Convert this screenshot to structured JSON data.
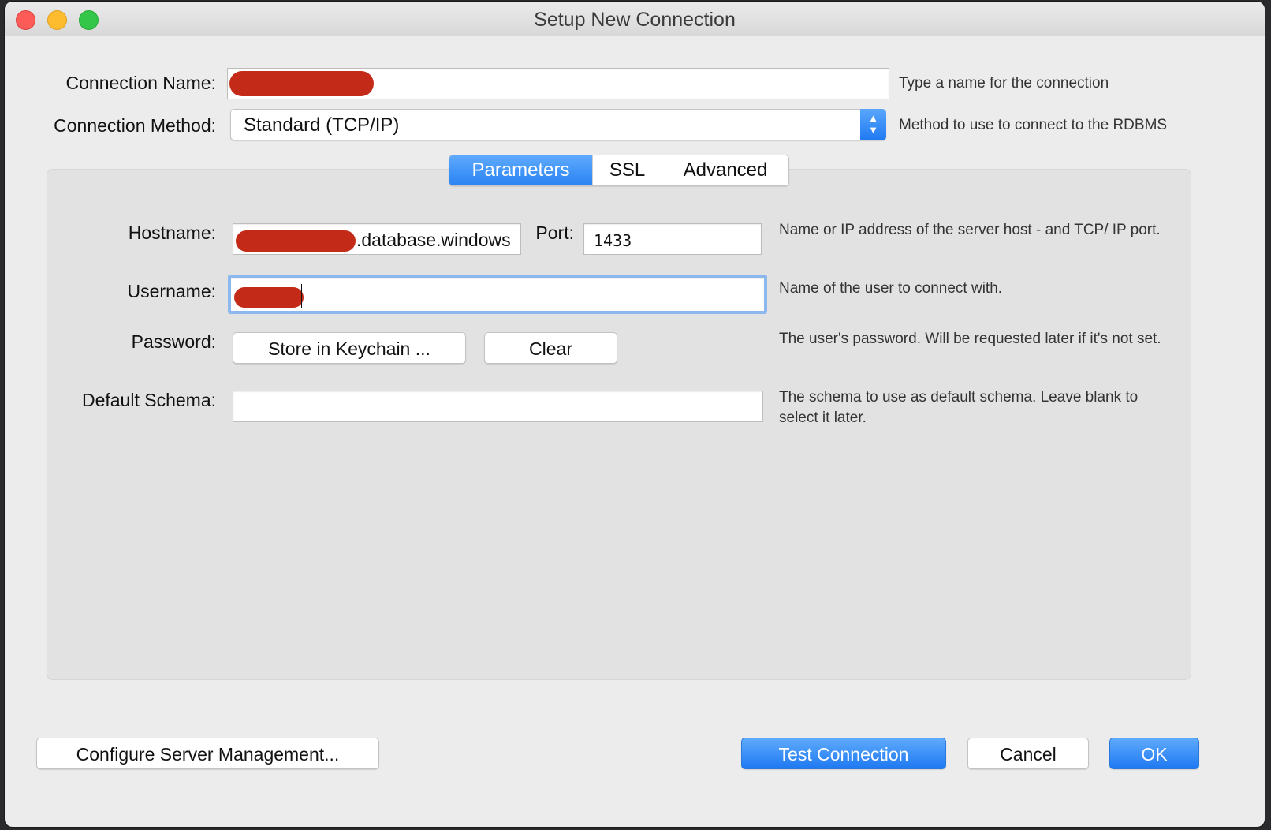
{
  "window": {
    "title": "Setup New Connection"
  },
  "form": {
    "connection_name_label": "Connection Name:",
    "connection_name_hint": "Type a name for the connection",
    "connection_method_label": "Connection Method:",
    "connection_method_value": "Standard (TCP/IP)",
    "connection_method_hint": "Method to use to connect to the RDBMS"
  },
  "tabs": [
    {
      "label": "Parameters",
      "active": true
    },
    {
      "label": "SSL",
      "active": false
    },
    {
      "label": "Advanced",
      "active": false
    }
  ],
  "parameters": {
    "hostname_label": "Hostname:",
    "hostname_visible_value": ".database.windows",
    "port_label": "Port:",
    "port_value": "1433",
    "hostname_hint": "Name or IP address of the server host - and TCP/ IP port.",
    "username_label": "Username:",
    "username_hint": "Name of the user to connect with.",
    "password_label": "Password:",
    "store_keychain_button": "Store in Keychain ...",
    "clear_button": "Clear",
    "password_hint": "The user's password. Will be requested later if it's not set.",
    "default_schema_label": "Default Schema:",
    "default_schema_value": "",
    "default_schema_hint": "The schema to use as default schema. Leave blank to select it later."
  },
  "footer": {
    "configure_button": "Configure Server Management...",
    "test_button": "Test Connection",
    "cancel_button": "Cancel",
    "ok_button": "OK"
  },
  "colors": {
    "accent": "#2a84f4",
    "redaction": "#c42a18"
  }
}
